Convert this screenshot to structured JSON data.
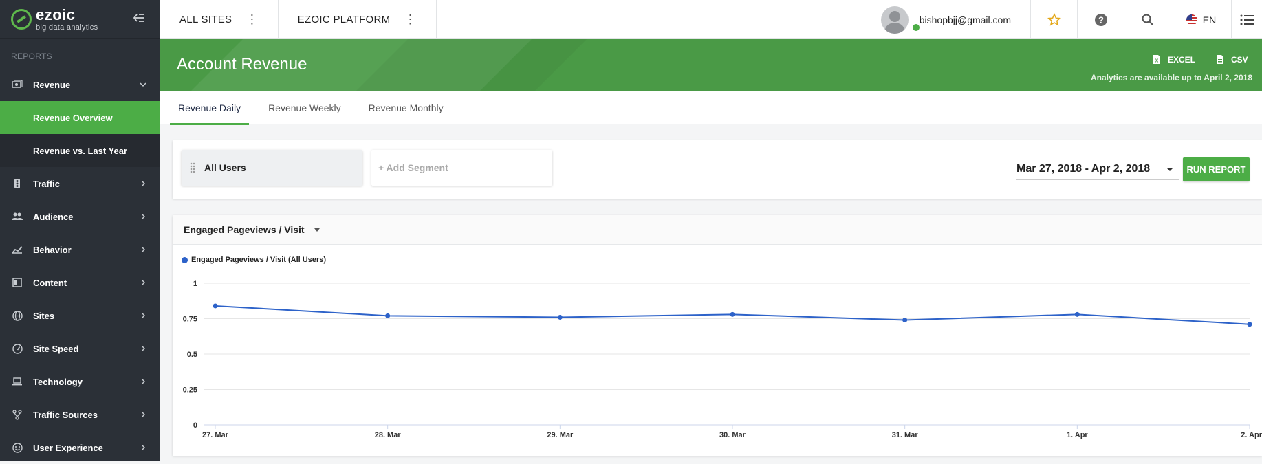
{
  "brand": {
    "name": "ezoic",
    "tagline": "big data analytics",
    "logo_icon": "ezoic-logo-icon"
  },
  "sidebar": {
    "section_label": "REPORTS",
    "items": [
      {
        "label": "Revenue",
        "icon": "revenue-icon",
        "expanded": true
      },
      {
        "label": "Traffic",
        "icon": "traffic-icon"
      },
      {
        "label": "Audience",
        "icon": "audience-icon"
      },
      {
        "label": "Behavior",
        "icon": "behavior-icon"
      },
      {
        "label": "Content",
        "icon": "content-icon"
      },
      {
        "label": "Sites",
        "icon": "globe-icon"
      },
      {
        "label": "Site Speed",
        "icon": "speedometer-icon"
      },
      {
        "label": "Technology",
        "icon": "laptop-icon"
      },
      {
        "label": "Traffic Sources",
        "icon": "source-icon"
      },
      {
        "label": "User Experience",
        "icon": "smiley-icon"
      }
    ],
    "revenue_sub": [
      {
        "label": "Revenue Overview",
        "active": true
      },
      {
        "label": "Revenue vs. Last Year",
        "active": false
      }
    ]
  },
  "topbar": {
    "site_selector": "ALL SITES",
    "platform_selector": "EZOIC PLATFORM",
    "user_email": "bishopbjj@gmail.com",
    "language": "EN"
  },
  "header": {
    "title": "Account Revenue",
    "excel_label": "EXCEL",
    "csv_label": "CSV",
    "availability": "Analytics are available up to April 2, 2018"
  },
  "tabs": [
    {
      "label": "Revenue Daily",
      "active": true
    },
    {
      "label": "Revenue Weekly",
      "active": false
    },
    {
      "label": "Revenue Monthly",
      "active": false
    }
  ],
  "segments": {
    "current": "All Users",
    "add_label": "+ Add Segment"
  },
  "date_range": "Mar 27, 2018 - Apr 2, 2018",
  "run_report_label": "RUN REPORT",
  "metric_selector": "Engaged Pageviews / Visit",
  "colors": {
    "accent_green": "#4cad46",
    "header_green": "#4a9a46",
    "sidebar_bg": "#2b3037",
    "series_blue": "#2d62c9"
  },
  "chart_data": {
    "type": "line",
    "x": [
      "27. Mar",
      "28. Mar",
      "29. Mar",
      "30. Mar",
      "31. Mar",
      "1. Apr",
      "2. Apr"
    ],
    "series": [
      {
        "name": "Engaged Pageviews / Visit (All Users)",
        "values": [
          0.84,
          0.77,
          0.76,
          0.78,
          0.74,
          0.78,
          0.71
        ]
      }
    ],
    "ylim": [
      0,
      1
    ],
    "yticks": [
      "0",
      "0.25",
      "0.5",
      "0.75",
      "1"
    ],
    "grid": true,
    "legend": "top-left"
  }
}
